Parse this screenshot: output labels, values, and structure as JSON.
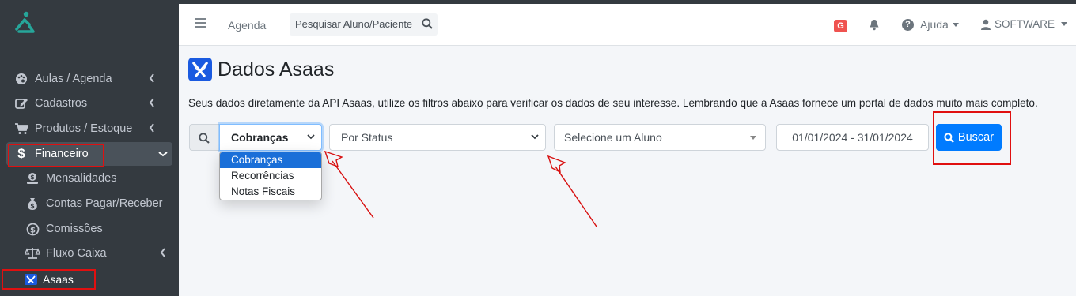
{
  "sidebar": {
    "items": [
      {
        "label": "Aulas / Agenda",
        "icon": "palette-icon"
      },
      {
        "label": "Cadastros",
        "icon": "edit-icon"
      },
      {
        "label": "Produtos / Estoque",
        "icon": "cart-icon"
      },
      {
        "label": "Financeiro",
        "icon": "dollar-icon"
      },
      {
        "label": "Mensalidades",
        "icon": "coin-hand-icon"
      },
      {
        "label": "Contas Pagar/Receber",
        "icon": "money-bag-icon"
      },
      {
        "label": "Comissões",
        "icon": "dollar-circle-icon"
      },
      {
        "label": "Fluxo Caixa",
        "icon": "balance-scale-icon"
      },
      {
        "label": "Asaas",
        "icon": "asaas-icon"
      }
    ]
  },
  "navbar": {
    "agenda": "Agenda",
    "search_placeholder": "Pesquisar Aluno/Paciente",
    "badge": "G",
    "help": "Ajuda",
    "user": "SOFTWARE"
  },
  "page": {
    "title": "Dados Asaas",
    "description": "Seus dados diretamente da API Asaas, utilize os filtros abaixo para verificar os dados de seu interesse. Lembrando que a Asaas fornece um portal de dados muito mais completo."
  },
  "filters": {
    "tipo_selected": "Cobranças",
    "tipo_options": [
      "Cobranças",
      "Recorrências",
      "Notas Fiscais"
    ],
    "status_selected": "Por Status",
    "aluno_selected": "Selecione um Aluno",
    "date_range": "01/01/2024 - 31/01/2024",
    "buscar": "Buscar"
  },
  "colors": {
    "sidebar_bg": "#343a40",
    "primary": "#007bff",
    "annotation": "#e01010"
  }
}
